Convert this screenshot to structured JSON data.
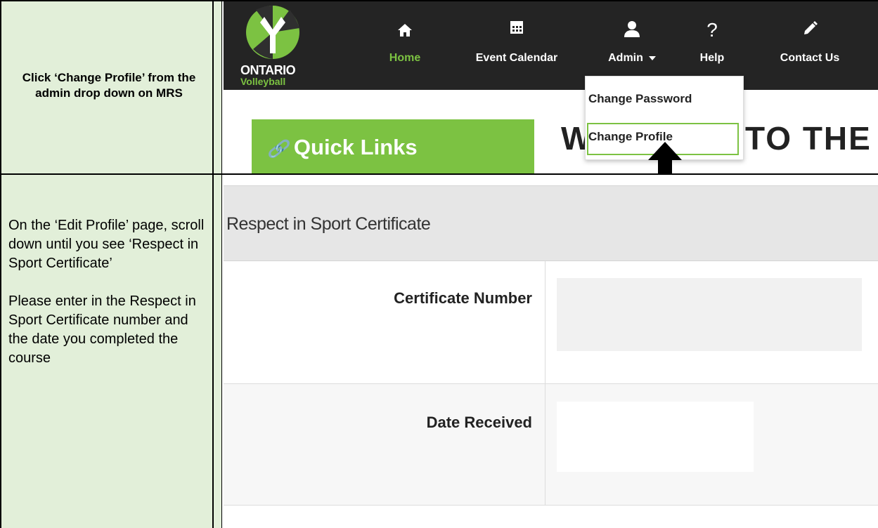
{
  "instructions": {
    "step1": "Click ‘Change Profile’ from the admin drop down on MRS",
    "step2_p1": "On the ‘Edit Profile’ page, scroll down until you see ‘Respect in Sport Certificate’",
    "step2_p2": "Please enter in the Respect in Sport Certificate number and the date you completed the course"
  },
  "logo": {
    "line1": "ONTARIO",
    "line2": "Volleyball"
  },
  "nav": {
    "items": [
      {
        "label": "Home",
        "icon": "home-icon",
        "active": true
      },
      {
        "label": "Event Calendar",
        "icon": "calendar-icon"
      },
      {
        "label": "Admin",
        "icon": "user-icon"
      },
      {
        "label": "Help",
        "icon": "question-icon"
      },
      {
        "label": "Contact Us",
        "icon": "pencil-icon"
      }
    ]
  },
  "admin_dropdown": {
    "items": [
      "Change Password",
      "Change Profile"
    ]
  },
  "quick_links": {
    "label": "Quick Links"
  },
  "welcome": {
    "part1": "W",
    "part2": "TO THE ("
  },
  "form": {
    "section_title": "Respect in Sport Certificate",
    "fields": [
      {
        "label": "Certificate Number",
        "value": ""
      },
      {
        "label": "Date Received",
        "value": ""
      }
    ]
  },
  "colors": {
    "brand_green": "#7cc242",
    "nav_bg": "#242424",
    "cell_bg": "#e2efd9"
  }
}
